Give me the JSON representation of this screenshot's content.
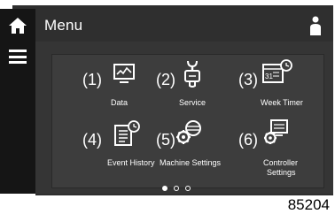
{
  "header": {
    "title": "Menu",
    "home_icon": "home-icon",
    "user_icon": "user-icon"
  },
  "sidebar": {
    "menu_icon": "hamburger-menu-icon"
  },
  "tiles": [
    {
      "number": "(1)",
      "label": "Data",
      "icon": "data-chart-icon"
    },
    {
      "number": "(2)",
      "label": "Service",
      "icon": "service-wrench-icon"
    },
    {
      "number": "(3)",
      "label": "Week Timer",
      "icon": "week-timer-icon"
    },
    {
      "number": "(4)",
      "label": "Event History",
      "icon": "event-history-icon"
    },
    {
      "number": "(5)",
      "label": "Machine Settings",
      "icon": "machine-settings-icon"
    },
    {
      "number": "(6)",
      "label": "Controller",
      "label2": "Settings",
      "icon": "controller-settings-icon"
    }
  ],
  "pagination": {
    "pages": 3,
    "active": 1
  },
  "figure_number": "85204",
  "colors": {
    "background": "#353535",
    "header": "#2f2f2f",
    "sidebar": "#151515",
    "text": "#ffffff"
  }
}
